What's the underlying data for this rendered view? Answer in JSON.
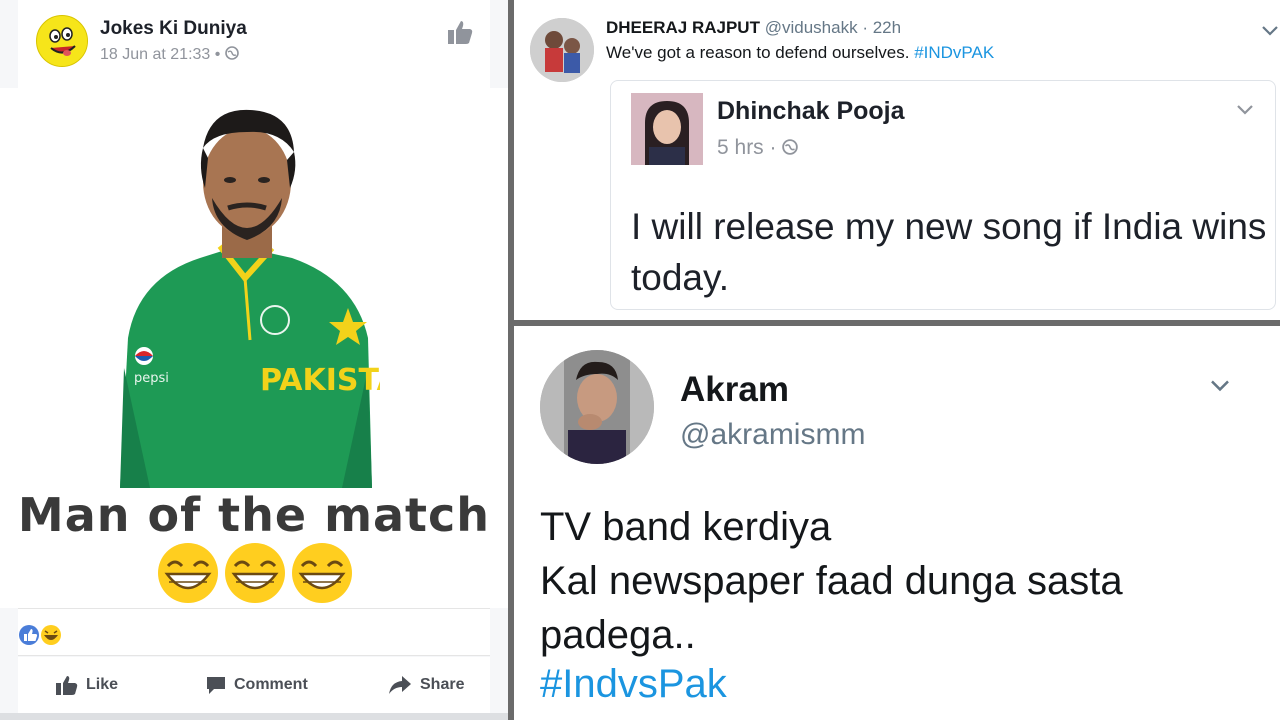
{
  "facebook_post": {
    "page_name": "Jokes Ki Duniya",
    "timestamp": "18 Jun at 21:33",
    "separator": "•",
    "jersey_text": "PAKISTA",
    "image_caption": "Man of the match",
    "actions": {
      "like": "Like",
      "comment": "Comment",
      "share": "Share"
    },
    "colors": {
      "jersey": "#1e9a55",
      "emoji": "#ffce1f",
      "like_blue": "#4a7dd8"
    }
  },
  "tweet_top": {
    "author_name": "DHEERAJ RAJPUT",
    "author_handle": "@vidushakk",
    "time": "· 22h",
    "text": "We've got a reason to defend ourselves. ",
    "hashtag": "#INDvPAK",
    "quoted": {
      "name": "Dhinchak Pooja",
      "time": "5 hrs ·",
      "text": "I will release my new song if India wins today."
    }
  },
  "tweet_bottom": {
    "name": "Akram",
    "handle": "@akramismm",
    "line1": "TV band kerdiya",
    "line2": "Kal newspaper faad dunga sasta padega..",
    "hashtag": "#IndvsPak"
  }
}
